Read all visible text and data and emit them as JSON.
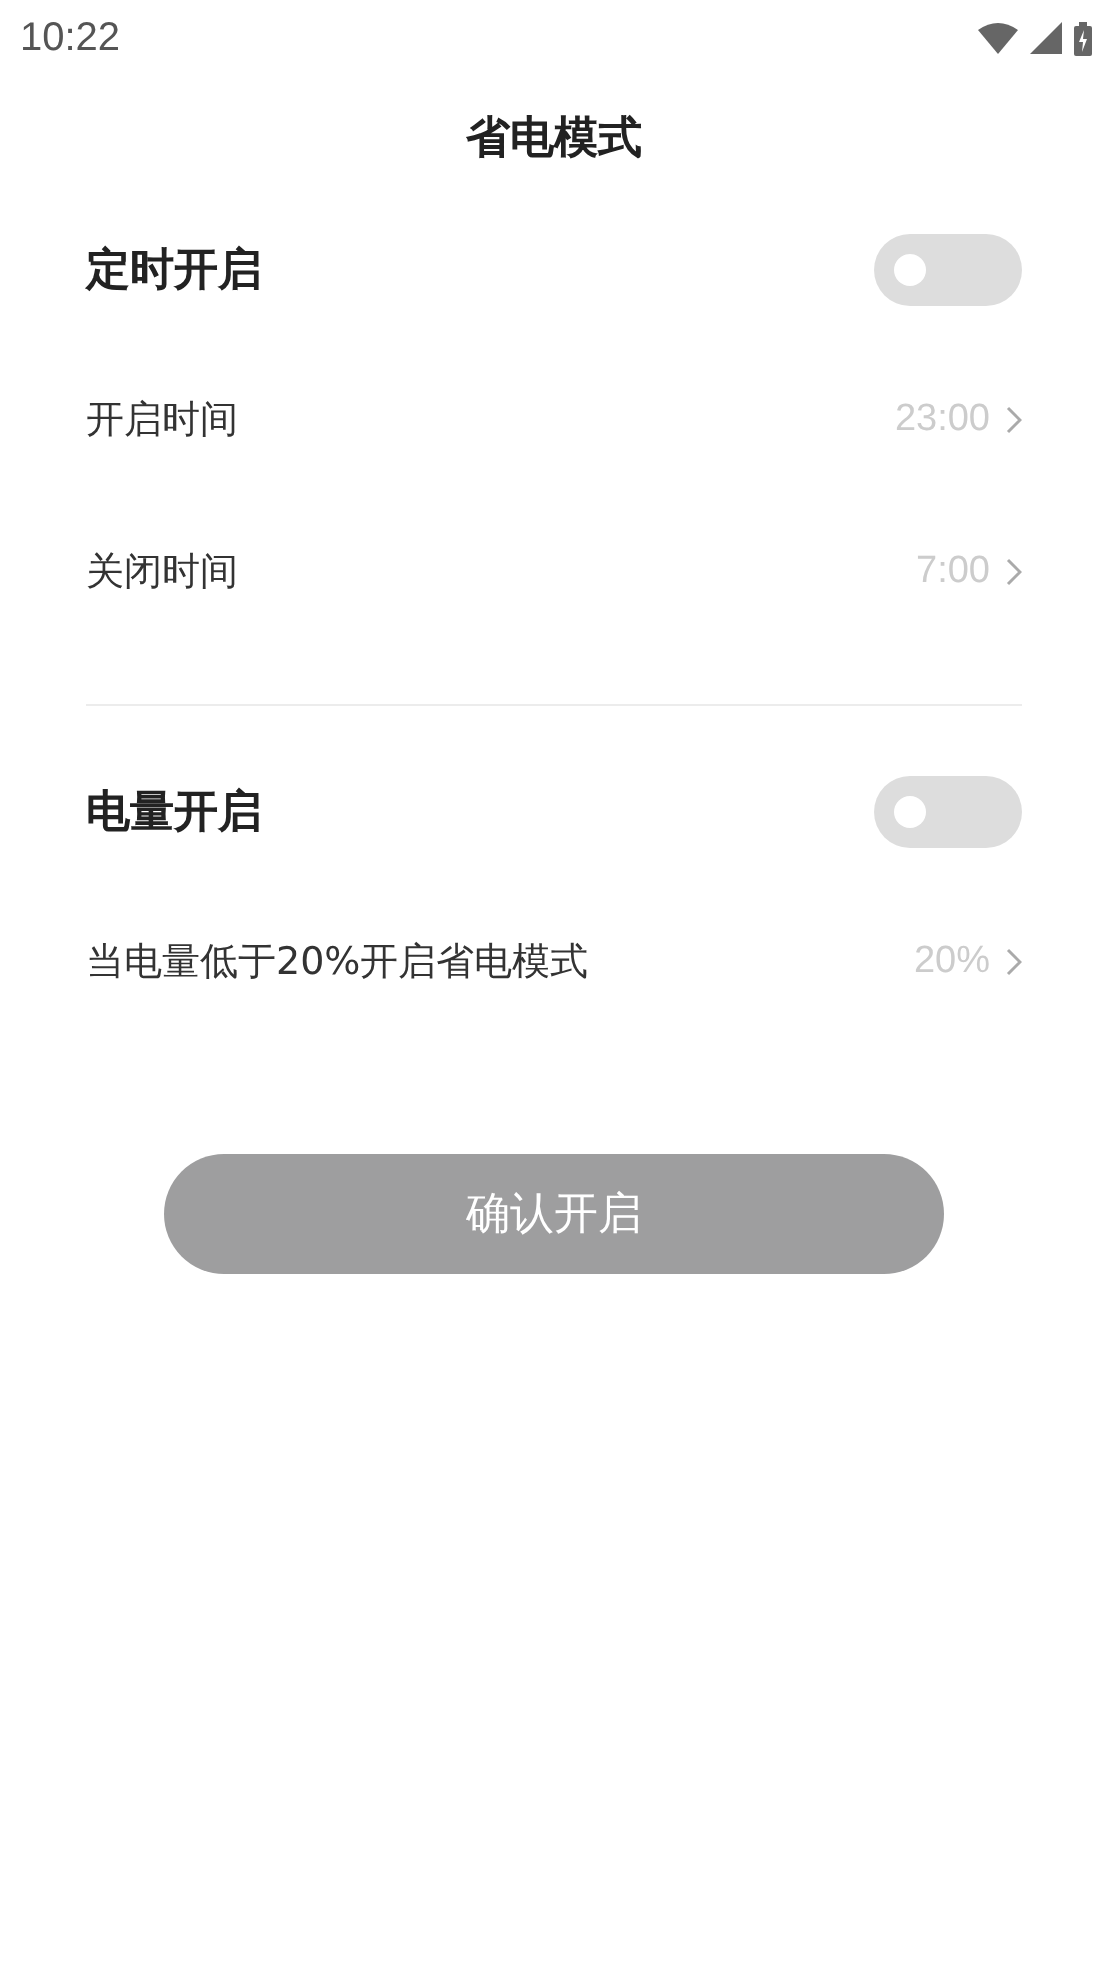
{
  "status_bar": {
    "time": "10:22"
  },
  "title": "省电模式",
  "sections": [
    {
      "title": "定时开启",
      "toggle": {
        "on": false
      },
      "rows": [
        {
          "label": "开启时间",
          "value": "23:00"
        },
        {
          "label": "关闭时间",
          "value": "7:00"
        }
      ]
    },
    {
      "title": "电量开启",
      "toggle": {
        "on": false
      },
      "rows": [
        {
          "label": "当电量低于20%开启省电模式",
          "value": "20%"
        }
      ]
    }
  ],
  "confirm_button": {
    "label": "确认开启"
  }
}
